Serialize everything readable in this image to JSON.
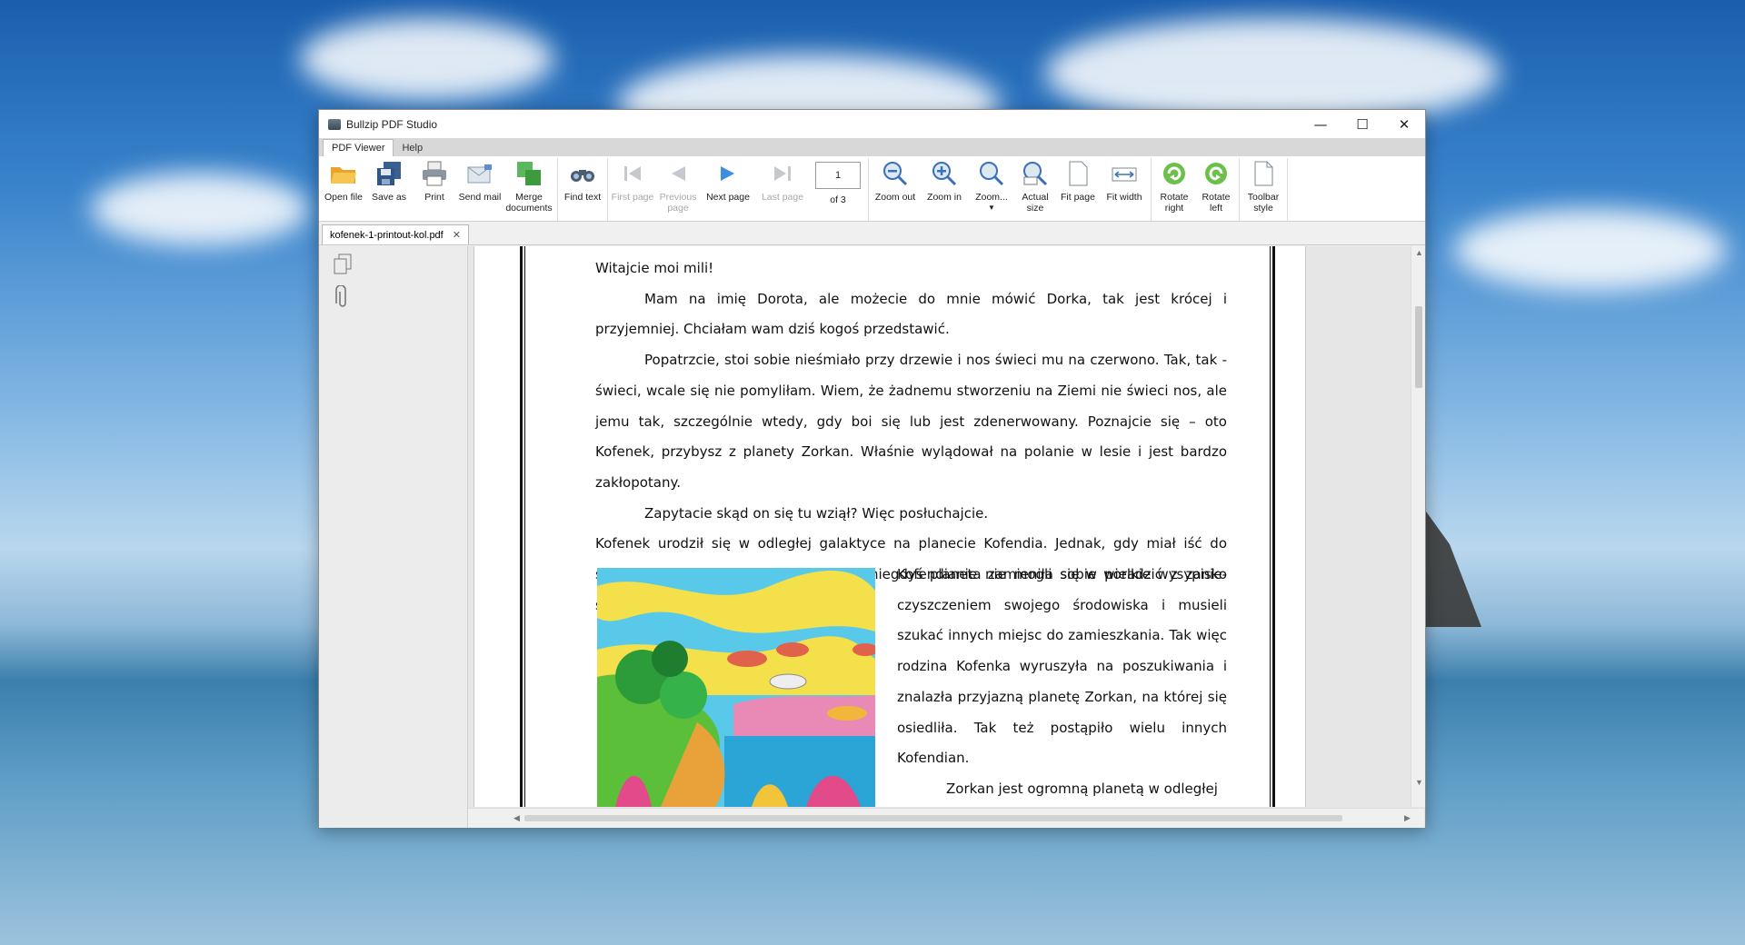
{
  "window": {
    "title": "Bullzip PDF Studio",
    "minimize": "—",
    "maximize": "☐",
    "close": "✕"
  },
  "ribbon_tabs": [
    "PDF Viewer",
    "Help"
  ],
  "toolbar": {
    "open_file": "Open file",
    "save_as": "Save as",
    "print": "Print",
    "send_mail": "Send mail",
    "merge_documents": "Merge documents",
    "find_text": "Find text",
    "first_page": "First page",
    "previous_page": "Previous page",
    "next_page": "Next page",
    "last_page": "Last page",
    "page_value": "1",
    "page_of": "of 3",
    "zoom_out": "Zoom out",
    "zoom_in": "Zoom in",
    "zoom": "Zoom...",
    "actual_size": "Actual size",
    "fit_page": "Fit page",
    "fit_width": "Fit width",
    "rotate_right": "Rotate right",
    "rotate_left": "Rotate left",
    "toolbar_style": "Toolbar style"
  },
  "document_tab": {
    "name": "kofenek-1-printout-kol.pdf",
    "close": "✕"
  },
  "pdf": {
    "p1": "Witajcie moi mili!",
    "p2": "Mam na imię Dorota, ale możecie do mnie mówić Dorka, tak jest krócej i przyjemniej. Chciałam wam dziś kogoś przedstawić.",
    "p3": "Popatrzcie, stoi sobie nieśmiało przy drzewie i nos świeci mu na czerwono. Tak, tak - świeci, wcale się nie pomyliłam. Wiem, że żadnemu stworzeniu na Ziemi nie świeci nos, ale jemu tak, szczególnie wtedy, gdy boi się lub jest zdenerwowany. Poznajcie się – oto Kofenek, przybysz z planety Zorkan. Właśnie wylądował na polanie w lesie i jest bardzo zakłopotany.",
    "p4": "Zapytacie skąd on się tu wziął? Więc posłuchajcie.",
    "p5": "Kofenek urodził się w odległej galaktyce na planecie Kofendia. Jednak, gdy miał iść do szkoły, okazało się, że jego wspaniała niegdyś planeta zamieniła się w wielkie wysypisko śmieci.",
    "p6": "Kofendianie nie mogli sobie poradzić z zanie-czyszczeniem swojego środowiska i musieli szukać innych miejsc do zamieszkania. Tak więc rodzina Kofenka wyruszyła na poszukiwania i znalazła przyjazną planetę Zorkan, na której się osiedliła. Tak też postąpiło wielu innych Kofendian.",
    "p7": "Zorkan jest ogromną planetą w odległej"
  },
  "colors": {
    "ribbon_bg": "#ffffff",
    "accent_green": "#3aa63a",
    "accent_blue": "#2f7fd6"
  }
}
